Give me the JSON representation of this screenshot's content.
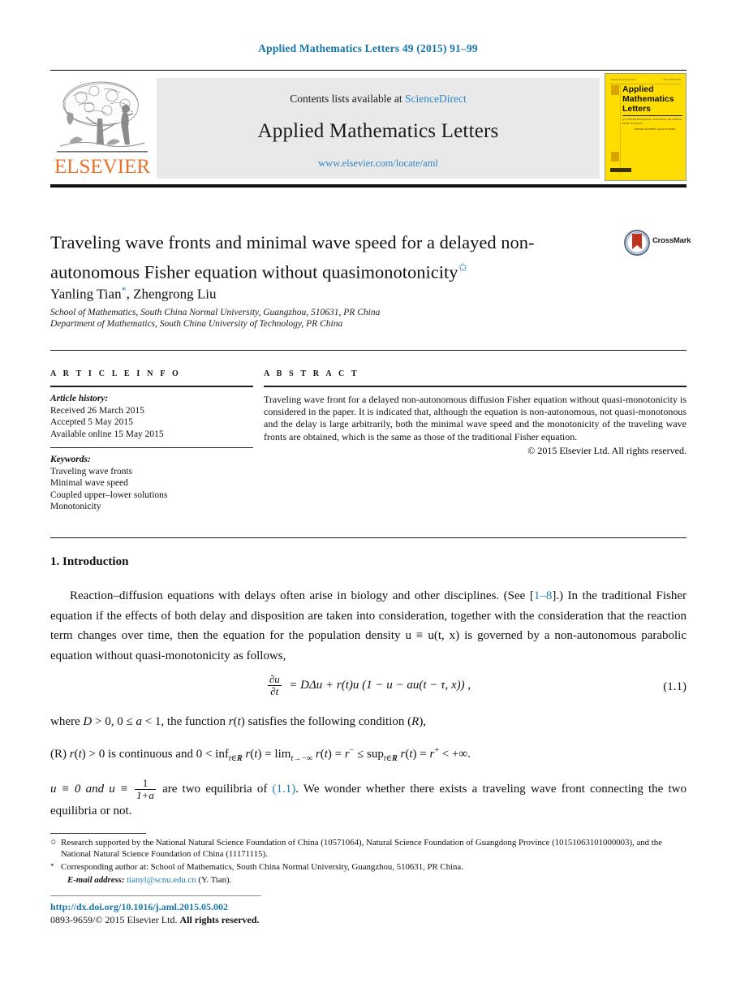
{
  "running_head": "Applied Mathematics Letters 49 (2015) 91–99",
  "masthead": {
    "contents_prefix": "Contents lists available at ",
    "sciencedirect": "ScienceDirect",
    "journal_title": "Applied Mathematics Letters",
    "journal_url": "www.elsevier.com/locate/aml",
    "publisher": "ELSEVIER",
    "cover": {
      "volume_line": "Volume 49 January 2015",
      "issn_line": "ISSN 0893-9659",
      "title_line1": "Applied",
      "title_line2": "Mathematics",
      "title_line3": "Letters",
      "subtitle": "AN INTERNATIONAL JOURNAL OF RAPID PUBLICATION",
      "editors": "EDITOR-IN-CHIEF: ALAN TUCKER"
    }
  },
  "article": {
    "title": "Traveling wave fronts and minimal wave speed for a delayed non-autonomous Fisher equation without quasimonotonicity",
    "title_marker": "✩",
    "authors": "Yanling Tian",
    "author_marker": "*",
    "authors_rest": ", Zhengrong Liu",
    "affiliations": [
      "School of Mathematics, South China Normal University, Guangzhou, 510631, PR China",
      "Department of Mathematics, South China University of Technology, PR China"
    ],
    "crossmark_label": "CrossMark"
  },
  "info": {
    "heading": "A R T I C L E    I N F O",
    "history_label": "Article history:",
    "history": [
      "Received 26 March 2015",
      "Accepted 5 May 2015",
      "Available online 15 May 2015"
    ],
    "keywords_label": "Keywords:",
    "keywords": [
      "Traveling wave fronts",
      "Minimal wave speed",
      "Coupled upper–lower solutions",
      "Monotonicity"
    ]
  },
  "abstract": {
    "heading": "A B S T R A C T",
    "text": "Traveling wave front for a delayed non-autonomous diffusion Fisher equation without quasi-monotonicity is considered in the paper. It is indicated that, although the equation is non-autonomous, not quasi-monotonous and the delay is large arbitrarily, both the minimal wave speed and the monotonicity of the traveling wave fronts are obtained, which is the same as those of the traditional Fisher equation.",
    "copyright": "© 2015 Elsevier Ltd. All rights reserved."
  },
  "body": {
    "section_heading": "1. Introduction",
    "paragraph1_a": "Reaction–diffusion equations with delays often arise in biology and other disciplines. (See ",
    "paragraph1_ref": "1–8",
    "paragraph1_b": "].) In the traditional Fisher equation if the effects of both delay and disposition are taken into consideration, together with the consideration that the reaction term changes over time, then the equation for the population density u ≡ u(t, x) is governed by a non-autonomous parabolic equation without quasi-monotonicity as follows,",
    "equation_number": "(1.1)",
    "equation_text": "∂u/∂t = DΔu + r(t)u (1 − u − au(t − τ, x)),",
    "paragraph2": "where D > 0, 0 ≤ a < 1, the function r(t) satisfies the following condition (R),",
    "paragraph3": "(R) r(t) > 0 is continuous and 0 < inf t∈R r(t) = lim t→−∞ r(t) = r⁻ ≤ sup t∈R r(t) = r⁺ < +∞.",
    "paragraph4_a": "u ≡ 0 and u ≡ ",
    "paragraph4_frac_num": "1",
    "paragraph4_frac_den": "1+a",
    "paragraph4_b": " are two equilibria of ",
    "paragraph4_ref": "(1.1)",
    "paragraph4_c": ". We wonder whether there exists a traveling wave front connecting the two equilibria or not."
  },
  "footnotes": {
    "funding_marker": "✩",
    "funding": "Research supported by the National Natural Science Foundation of China (10571064), Natural Science Foundation of Guangdong Province (10151063101000003), and the National Natural Science Foundation of China (11171115).",
    "corresponding_marker": "*",
    "corresponding": "Corresponding author at: School of Mathematics, South China Normal University, Guangzhou, 510631, PR China.",
    "email_label": "E-mail address:",
    "email": "tianyl@scnu.edu.cn",
    "email_who": "(Y. Tian)."
  },
  "footer": {
    "doi": "http://dx.doi.org/10.1016/j.aml.2015.05.002",
    "issn_prefix": "0893-9659/",
    "issn_rest": "© 2015 Elsevier Ltd. ",
    "issn_bold": "All rights reserved."
  },
  "colors": {
    "link": "#1d7fae",
    "brand_orange": "#e8732b",
    "cover_yellow": "#ffdd00",
    "sciencedirect": "#2e87c4"
  }
}
